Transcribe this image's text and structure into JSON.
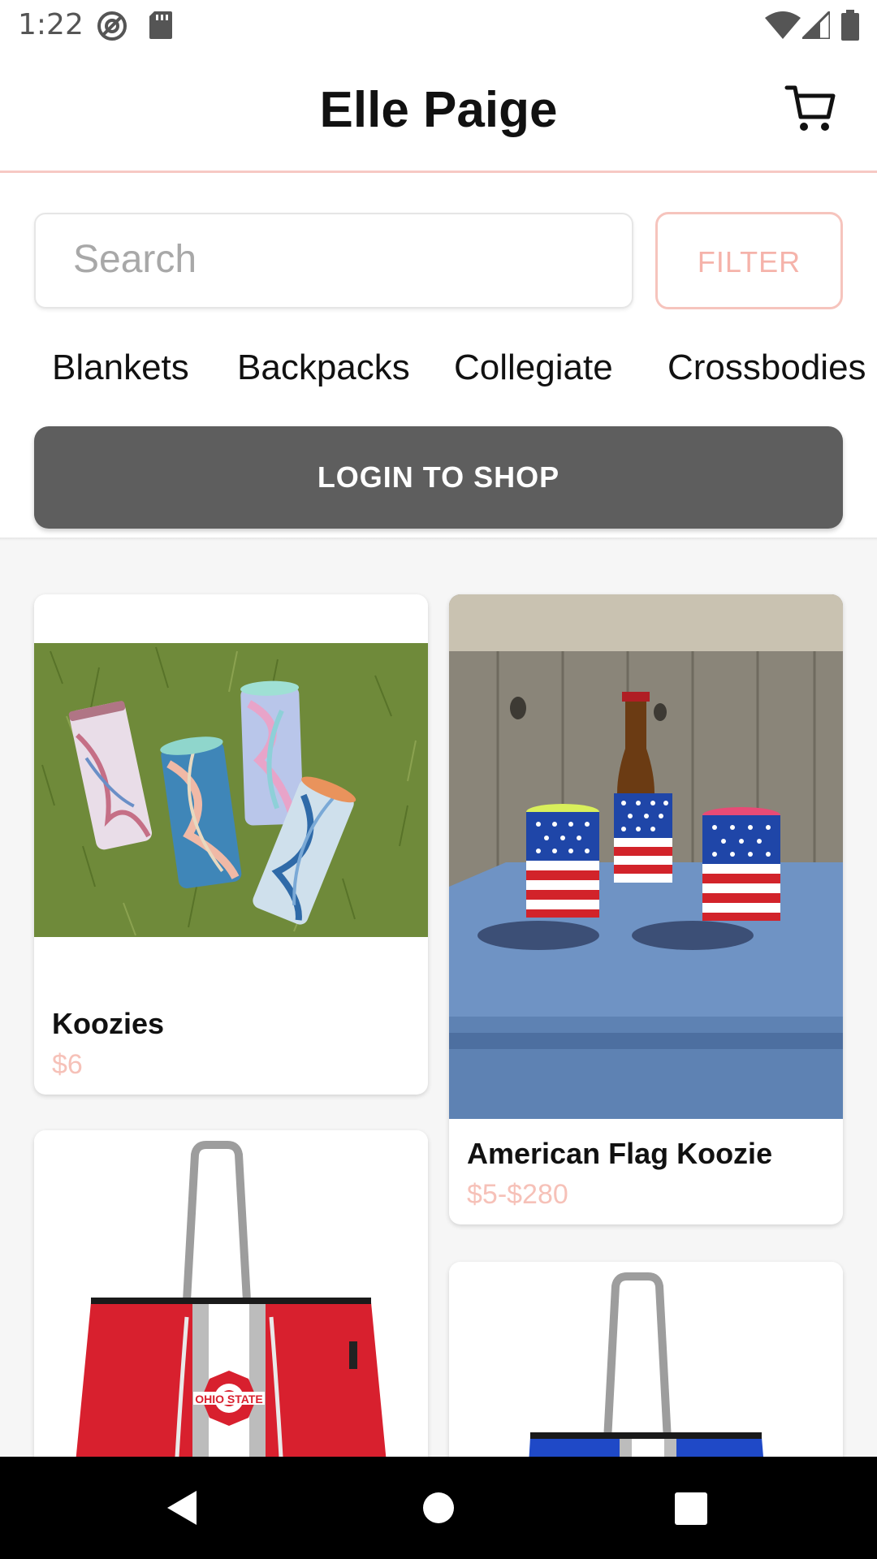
{
  "status_bar": {
    "time": "1:22",
    "left_icons": [
      "at-sign-icon",
      "sd-card-icon"
    ],
    "right_icons": [
      "wifi-icon",
      "signal-icon",
      "battery-icon"
    ]
  },
  "header": {
    "title": "Elle Paige",
    "cart_icon": "cart-icon"
  },
  "search": {
    "placeholder": "Search",
    "filter_label": "FILTER"
  },
  "categories": [
    "Blankets",
    "Backpacks",
    "Collegiate",
    "Crossbodies"
  ],
  "login_button": "LOGIN TO SHOP",
  "products": [
    {
      "title": "Koozies",
      "price": "$6",
      "image": "marble-koozies-on-grass"
    },
    {
      "title": "American Flag Koozie",
      "price": "$5-$280",
      "image": "flag-koozies-on-cooler"
    },
    {
      "title": "",
      "price": "",
      "image": "ohio-state-red-tote"
    },
    {
      "title": "",
      "price": "",
      "image": "blue-tote"
    }
  ],
  "nav_bar": {
    "back": "back-triangle-icon",
    "home": "home-circle-icon",
    "recents": "recents-square-icon"
  },
  "colors": {
    "accent": "#f5b3aa",
    "login_bg": "#5e5e5e",
    "header_border": "#f7c9c4"
  }
}
